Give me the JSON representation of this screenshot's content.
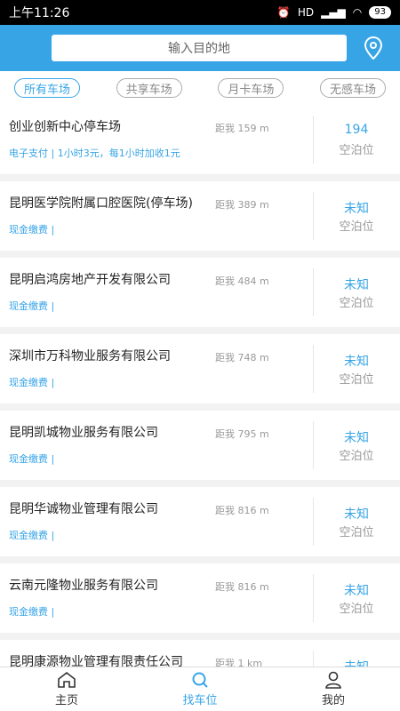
{
  "status": {
    "time": "上午11:26",
    "signal": "HD",
    "battery": "93"
  },
  "header": {
    "search_placeholder": "输入目的地",
    "location_icon": "location-pin-icon"
  },
  "tabs": [
    {
      "label": "所有车场",
      "active": true
    },
    {
      "label": "共享车场",
      "active": false
    },
    {
      "label": "月卡车场",
      "active": false
    },
    {
      "label": "无感车场",
      "active": false
    }
  ],
  "lots": [
    {
      "name": "创业创新中心停车场",
      "distance": "距我 159 m",
      "payment": "电子支付 | 1小时3元，每1小时加收1元",
      "spots": "194",
      "spots_label": "空泊位"
    },
    {
      "name": "昆明医学院附属口腔医院(停车场)",
      "distance": "距我 389 m",
      "payment": "现金缴费 |",
      "spots": "未知",
      "spots_label": "空泊位"
    },
    {
      "name": "昆明启鸿房地产开发有限公司",
      "distance": "距我 484 m",
      "payment": "现金缴费 |",
      "spots": "未知",
      "spots_label": "空泊位"
    },
    {
      "name": "深圳市万科物业服务有限公司",
      "distance": "距我 748 m",
      "payment": "现金缴费 |",
      "spots": "未知",
      "spots_label": "空泊位"
    },
    {
      "name": "昆明凯城物业服务有限公司",
      "distance": "距我 795 m",
      "payment": "现金缴费 |",
      "spots": "未知",
      "spots_label": "空泊位"
    },
    {
      "name": "昆明华诚物业管理有限公司",
      "distance": "距我 816 m",
      "payment": "现金缴费 |",
      "spots": "未知",
      "spots_label": "空泊位"
    },
    {
      "name": "云南元隆物业服务有限公司",
      "distance": "距我 816 m",
      "payment": "现金缴费 |",
      "spots": "未知",
      "spots_label": "空泊位"
    },
    {
      "name": "昆明康源物业管理有限责任公司",
      "distance": "距我 1 km",
      "payment": "",
      "spots": "未知",
      "spots_label": ""
    }
  ],
  "nav": {
    "home": "主页",
    "find": "找车位",
    "mine": "我的"
  },
  "colors": {
    "accent": "#37a4e6"
  }
}
